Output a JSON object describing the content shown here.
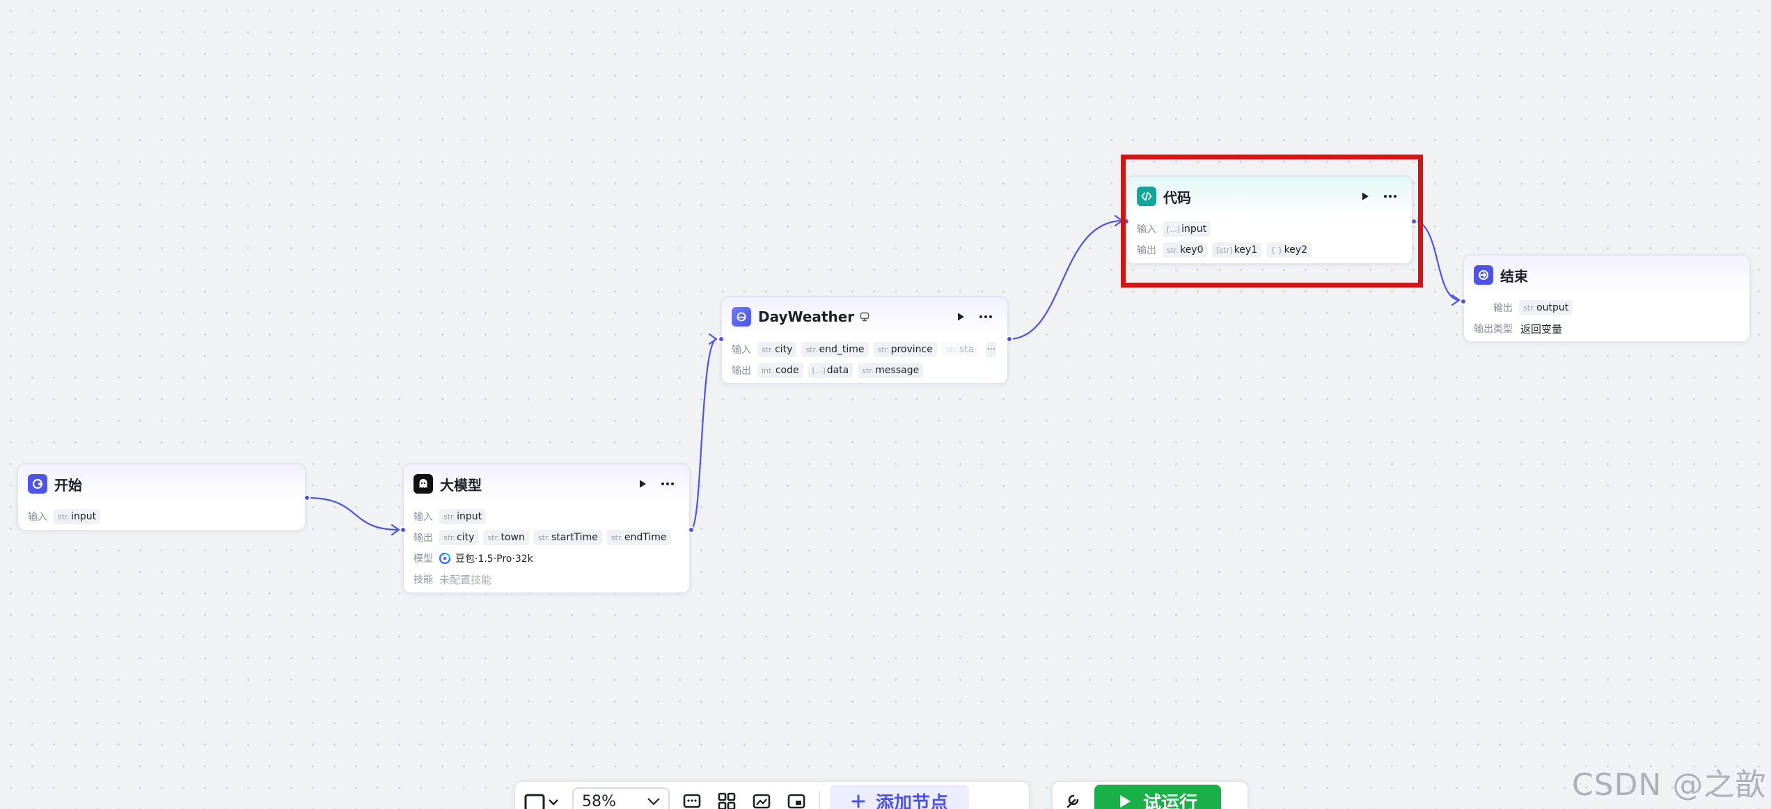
{
  "nodes": {
    "start": {
      "title": "开始",
      "input_label": "输入",
      "inputs": [
        {
          "type": "str.",
          "name": "input"
        }
      ]
    },
    "llm": {
      "title": "大模型",
      "input_label": "输入",
      "output_label": "输出",
      "model_label": "模型",
      "skill_label": "技能",
      "inputs": [
        {
          "type": "str.",
          "name": "input"
        }
      ],
      "outputs": [
        {
          "type": "str.",
          "name": "city"
        },
        {
          "type": "str.",
          "name": "town"
        },
        {
          "type": "str.",
          "name": "startTime"
        },
        {
          "type": "str.",
          "name": "endTime"
        }
      ],
      "model": "豆包·1.5·Pro·32k",
      "skill": "未配置技能"
    },
    "weather": {
      "title": "DayWeather",
      "input_label": "输入",
      "output_label": "输出",
      "inputs": [
        {
          "type": "str.",
          "name": "city"
        },
        {
          "type": "str.",
          "name": "end_time"
        },
        {
          "type": "str.",
          "name": "province"
        },
        {
          "type": "str.",
          "name": "sta"
        }
      ],
      "more_inputs": "···",
      "outputs": [
        {
          "type": "int.",
          "name": "code"
        },
        {
          "type": "[...]",
          "name": "data"
        },
        {
          "type": "str.",
          "name": "message"
        }
      ]
    },
    "code": {
      "title": "代码",
      "input_label": "输入",
      "output_label": "输出",
      "inputs": [
        {
          "type": "[...]",
          "name": "input"
        }
      ],
      "outputs": [
        {
          "type": "str.",
          "name": "key0"
        },
        {
          "type": "[str]",
          "name": "key1"
        },
        {
          "type": "{ }",
          "name": "key2"
        }
      ]
    },
    "end": {
      "title": "结束",
      "output_label": "输出",
      "output_type_label": "输出类型",
      "outputs": [
        {
          "type": "str.",
          "name": "output"
        }
      ],
      "output_type": "返回变量"
    }
  },
  "toolbar": {
    "zoom": "58%",
    "add_node": "添加节点",
    "run": "试运行"
  },
  "watermark": "CSDN @之歆",
  "colors": {
    "accent": "#4d53e8",
    "highlight": "#d21414",
    "run": "#1ab048",
    "code_icon": "#14a59a"
  }
}
